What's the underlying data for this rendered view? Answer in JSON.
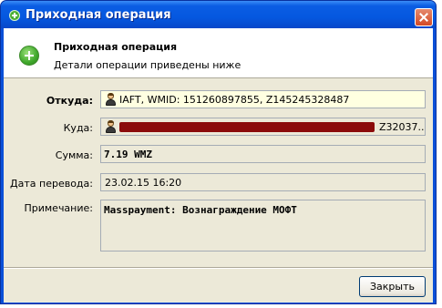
{
  "window": {
    "title": "Приходная операция",
    "colors": {
      "titlebar": "#0558e0",
      "face": "#ece9d8",
      "close": "#d44a26",
      "redaction": "#8b0b0b"
    }
  },
  "header": {
    "title": "Приходная операция",
    "subtitle": "Детали операции приведены ниже",
    "icon": "green-plus-icon"
  },
  "form": {
    "from": {
      "label": "Откуда:",
      "value": "IAFT, WMID: 151260897855, Z145245328487",
      "icon": "user-icon"
    },
    "to": {
      "label": "Куда:",
      "value_suffix": "Z32037...",
      "icon": "user-icon"
    },
    "amount": {
      "label": "Сумма:",
      "value": "7.19 WMZ"
    },
    "date": {
      "label": "Дата перевода:",
      "value": "23.02.15 16:20"
    },
    "note": {
      "label": "Примечание:",
      "value": "Masspayment: Вознаграждение МОФТ"
    }
  },
  "buttons": {
    "close": "Закрыть"
  }
}
